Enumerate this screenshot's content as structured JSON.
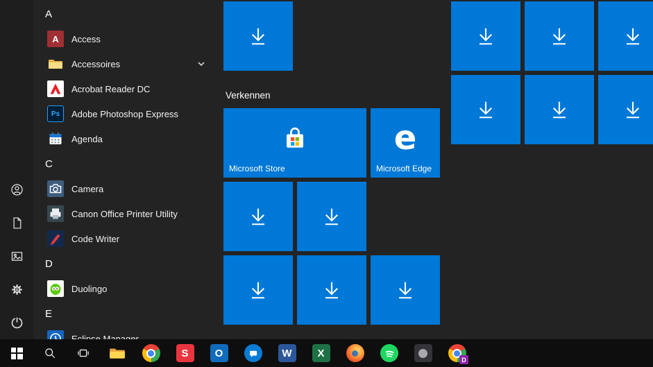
{
  "colors": {
    "accent_blue": "#0078d7",
    "menu_bg": "#232323",
    "taskbar_bg": "#0e0e0e",
    "text": "#ffffff"
  },
  "app_list": {
    "sections": [
      {
        "letter": "A",
        "apps": [
          {
            "label": "Access"
          },
          {
            "label": "Accessoires",
            "expandable": true
          },
          {
            "label": "Acrobat Reader DC"
          },
          {
            "label": "Adobe Photoshop Express"
          },
          {
            "label": "Agenda"
          }
        ]
      },
      {
        "letter": "C",
        "apps": [
          {
            "label": "Camera"
          },
          {
            "label": "Canon Office Printer Utility"
          },
          {
            "label": "Code Writer"
          }
        ]
      },
      {
        "letter": "D",
        "apps": [
          {
            "label": "Duolingo"
          }
        ]
      },
      {
        "letter": "E",
        "apps": [
          {
            "label": "Eclipse Manager"
          }
        ]
      }
    ]
  },
  "rail": {
    "items": [
      {
        "name": "account"
      },
      {
        "name": "documents"
      },
      {
        "name": "pictures"
      },
      {
        "name": "settings"
      },
      {
        "name": "power"
      }
    ]
  },
  "tiles": {
    "group_title": "Verkennen",
    "store_label": "Microsoft Store",
    "edge_label": "Microsoft Edge",
    "download_tile_count": 12
  },
  "glyphs": {
    "access": "A",
    "photoshop_express": "Ps",
    "edge_logo": "e"
  },
  "taskbar": {
    "items": [
      {
        "name": "start"
      },
      {
        "name": "search"
      },
      {
        "name": "task-view"
      },
      {
        "name": "file-explorer"
      },
      {
        "name": "chrome"
      },
      {
        "name": "red-s-app",
        "letter": "S"
      },
      {
        "name": "outlook",
        "letter": "O"
      },
      {
        "name": "messaging"
      },
      {
        "name": "word",
        "letter": "W"
      },
      {
        "name": "excel",
        "letter": "X"
      },
      {
        "name": "firefox"
      },
      {
        "name": "spotify"
      },
      {
        "name": "dark-app"
      },
      {
        "name": "chrome-profile",
        "badge": "D"
      }
    ]
  }
}
